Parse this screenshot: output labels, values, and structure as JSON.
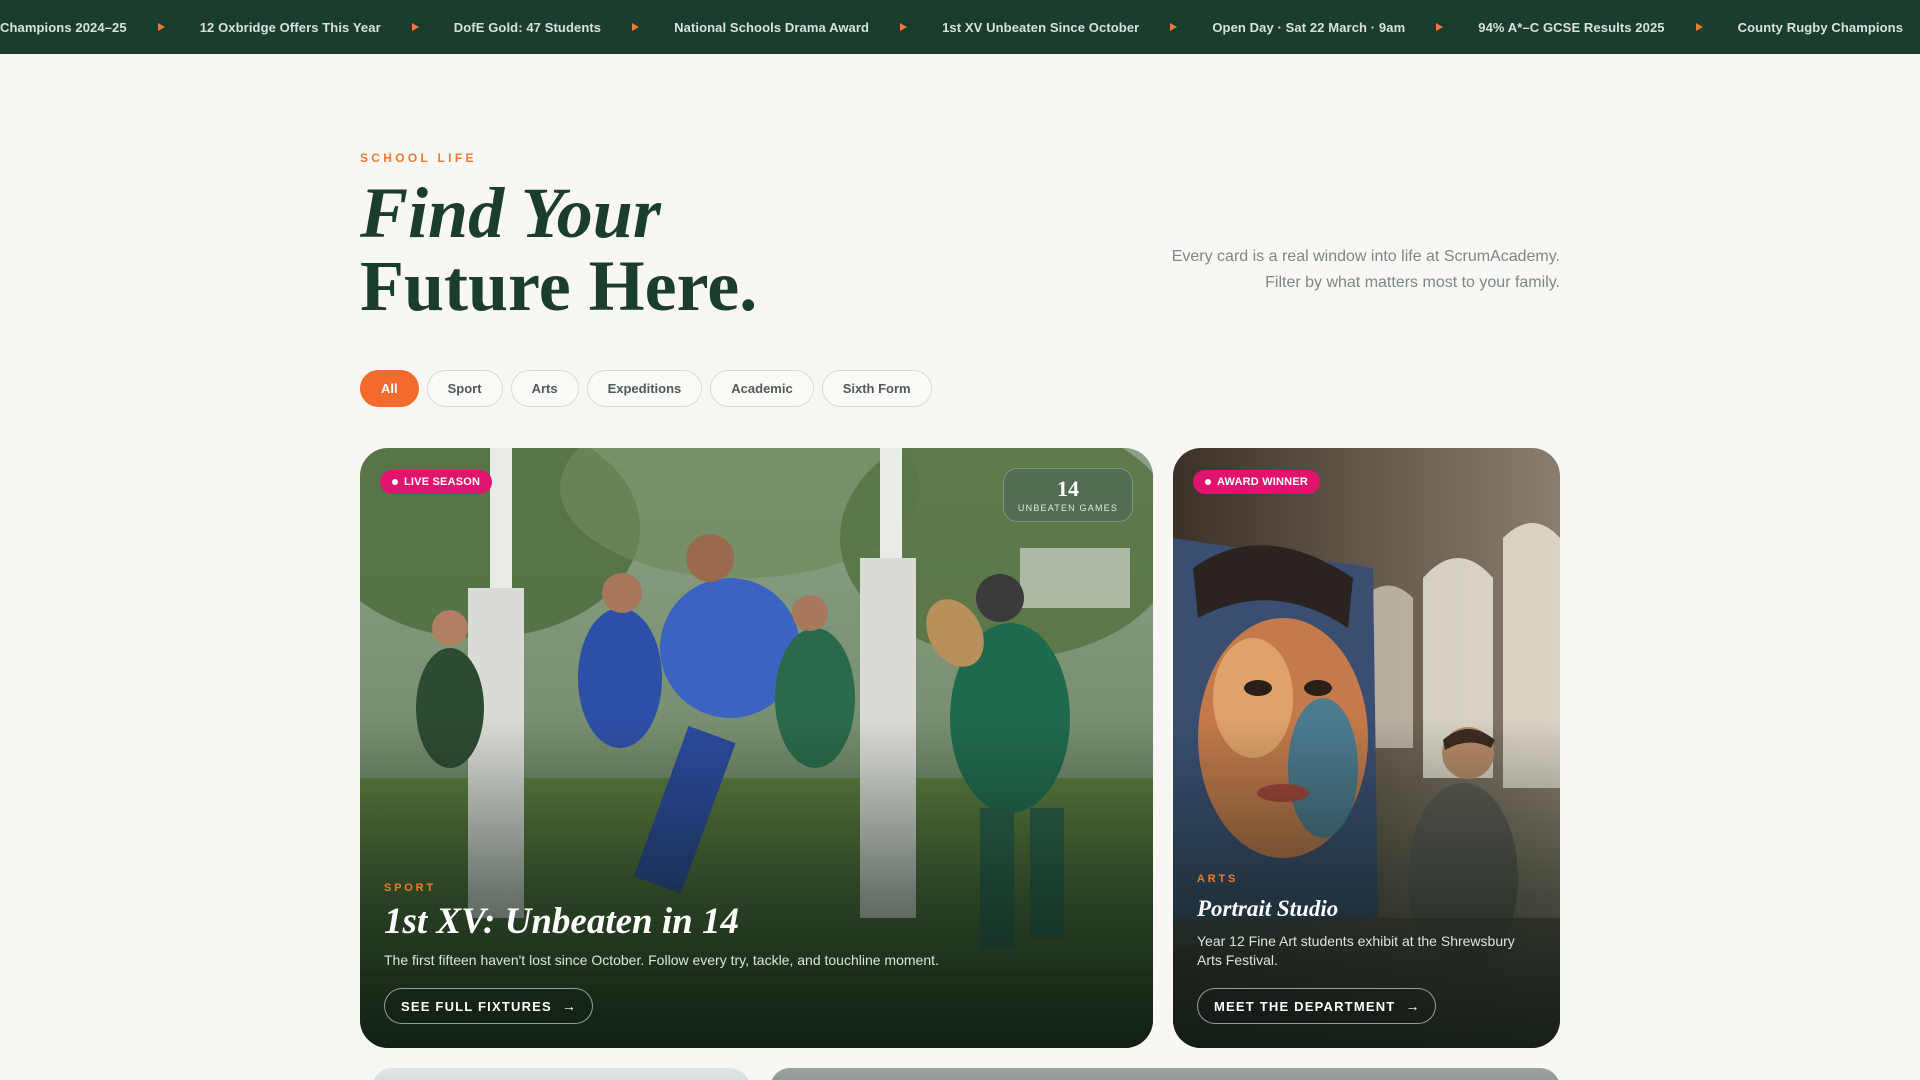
{
  "ticker": {
    "items": [
      "Champions 2024–25",
      "12 Oxbridge Offers This Year",
      "DofE Gold: 47 Students",
      "National Schools Drama Award",
      "1st XV Unbeaten Since October",
      "Open Day · Sat 22 March · 9am",
      "94% A*–C GCSE Results 2025",
      "County Rugby Champions"
    ]
  },
  "header": {
    "eyebrow": "SCHOOL LIFE",
    "title_line1": "Find Your",
    "title_line2": "Future Here.",
    "lead": "Every card is a real window into life at ScrumAcademy. Filter by what matters most to your family."
  },
  "filters": [
    {
      "label": "All",
      "active": true
    },
    {
      "label": "Sport",
      "active": false
    },
    {
      "label": "Arts",
      "active": false
    },
    {
      "label": "Expeditions",
      "active": false
    },
    {
      "label": "Academic",
      "active": false
    },
    {
      "label": "Sixth Form",
      "active": false
    }
  ],
  "cards": {
    "main": {
      "badge": "LIVE SEASON",
      "stat_value": "14",
      "stat_label": "UNBEATEN GAMES",
      "category": "SPORT",
      "title": "1st XV: Unbeaten in 14",
      "description": "The first fifteen haven't lost since October. Follow every try, tackle, and touchline moment.",
      "cta": "SEE FULL FIXTURES",
      "image": "rugby-match-photo"
    },
    "side": {
      "badge": "AWARD WINNER",
      "category": "ARTS",
      "title": "Portrait Studio",
      "description": "Year 12 Fine Art students exhibit at the Shrewsbury Arts Festival.",
      "cta": "MEET THE DEPARTMENT",
      "image": "portrait-painting-photo"
    }
  },
  "colors": {
    "ticker_bg": "#1b3d2d",
    "accent_orange": "#f36a2d",
    "badge_pink": "#e0146f",
    "heading_green": "#1b3d2d",
    "page_bg": "#f9f7f3"
  },
  "icons": {
    "ticker_separator": "triangle-right-icon",
    "cta_arrow": "arrow-right-icon"
  }
}
